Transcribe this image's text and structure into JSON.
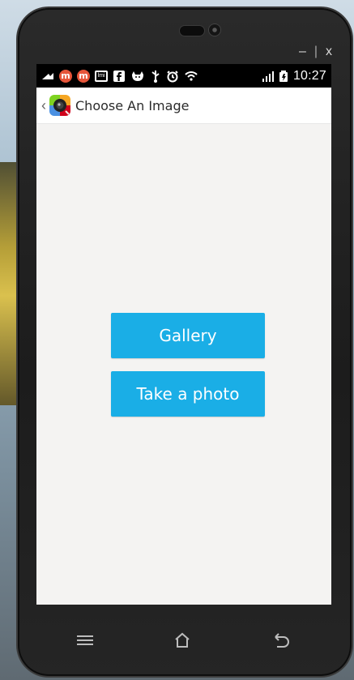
{
  "window": {
    "controls": {
      "minimize_glyph": "–",
      "separator_glyph": "|",
      "close_glyph": "x"
    }
  },
  "status_bar": {
    "time": "10:27",
    "icons": [
      "notification-icon",
      "m-app-icon",
      "m-app-icon",
      "lmi-icon",
      "facebook-icon",
      "cat-icon",
      "usb-icon",
      "alarm-icon",
      "wifi-icon",
      "signal-icon",
      "battery-icon"
    ]
  },
  "action_bar": {
    "title": "Choose An Image"
  },
  "buttons": {
    "gallery_label": "Gallery",
    "take_photo_label": "Take a photo"
  },
  "colors": {
    "accent": "#1aaee6",
    "screen_background": "#f4f3f2"
  },
  "navigation": {
    "menu_icon": "menu-icon",
    "home_icon": "home-icon",
    "back_icon": "back-icon"
  }
}
